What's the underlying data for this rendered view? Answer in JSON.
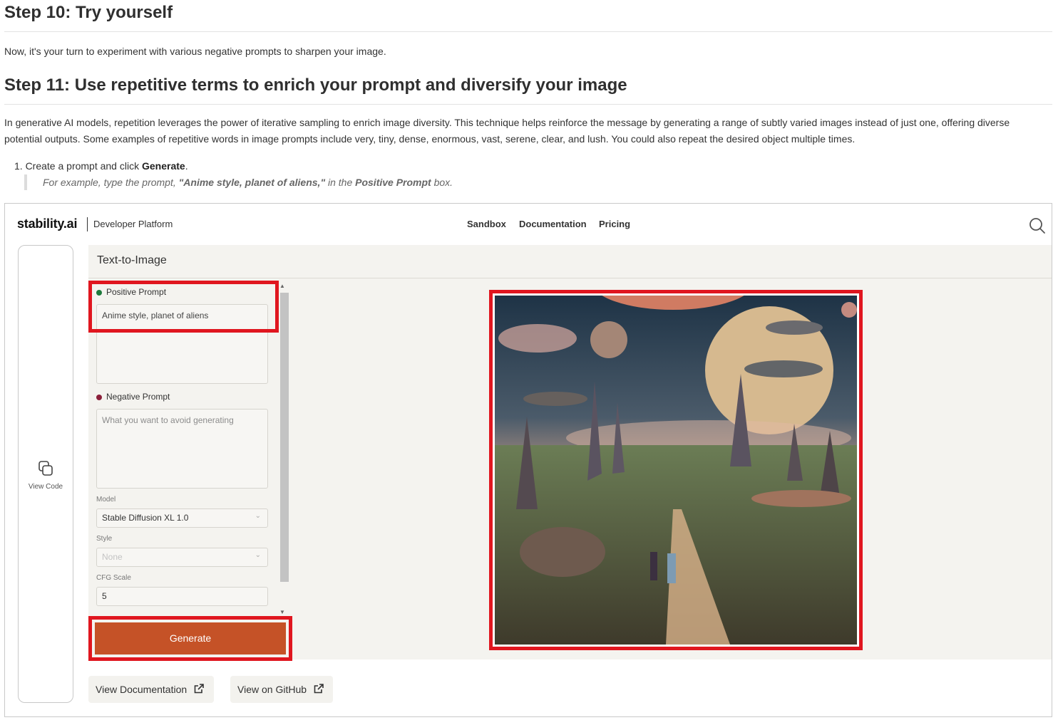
{
  "doc": {
    "step10_heading": "Step 10: Try yourself",
    "step10_text": "Now, it's your turn to experiment with various negative prompts to sharpen your image.",
    "step11_heading": "Step 11: Use repetitive terms to enrich your prompt and diversify your image",
    "step11_text": "In generative AI models, repetition leverages the power of iterative sampling to enrich image diversity. This technique helps reinforce the message by generating a range of subtly varied images instead of just one, offering diverse potential outputs. Some examples of repetitive words in image prompts include very, tiny, dense, enormous, vast, serene, clear, and lush. You could also repeat the desired object multiple times.",
    "list_item_prefix": "1. Create a prompt and click ",
    "list_item_bold": "Generate",
    "list_item_suffix": ".",
    "quote_prefix": "For example, type the prompt, ",
    "quote_bold_prompt": "\"Anime style, planet of aliens,\"",
    "quote_middle": " in the ",
    "quote_bold_box": "Positive Prompt",
    "quote_suffix": " box."
  },
  "app": {
    "logo": "stability.ai",
    "platform": "Developer Platform",
    "nav": {
      "sandbox": "Sandbox",
      "documentation": "Documentation",
      "pricing": "Pricing"
    },
    "sidebar": {
      "view_code": "View Code"
    },
    "title": "Text-to-Image",
    "positive_prompt": {
      "label": "Positive Prompt",
      "value": "Anime style, planet of aliens",
      "dot_color": "#1e7a3c"
    },
    "negative_prompt": {
      "label": "Negative Prompt",
      "placeholder": "What you want to avoid generating",
      "dot_color": "#8b1f3a"
    },
    "model": {
      "label": "Model",
      "value": "Stable Diffusion XL 1.0"
    },
    "style": {
      "label": "Style",
      "value": "None"
    },
    "cfg": {
      "label": "CFG Scale",
      "value": "5"
    },
    "generate_label": "Generate",
    "view_documentation": "View Documentation",
    "view_github": "View on GitHub",
    "accent_color": "#c55227",
    "highlight_color": "#e0161f"
  }
}
